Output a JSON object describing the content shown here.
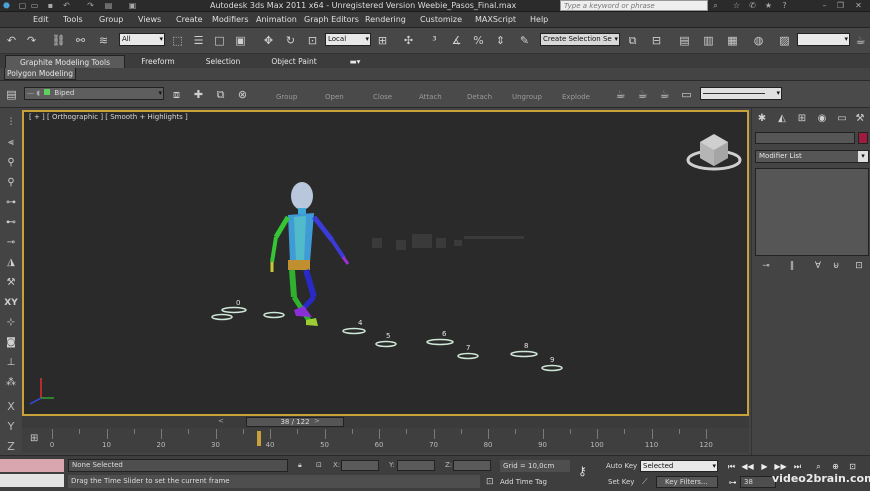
{
  "titlebar": {
    "title": "Autodesk 3ds Max  2011 x64   -  Unregistered Version   Weebie_Pasos_Final.max",
    "search_placeholder": "Type a keyword or phrase"
  },
  "menu": [
    "Edit",
    "Tools",
    "Group",
    "Views",
    "Create",
    "Modifiers",
    "Animation",
    "Graph Editors",
    "Rendering",
    "Customize",
    "MAXScript",
    "Help"
  ],
  "toolbar": {
    "selection_filter": "All",
    "ref_coord": "Local",
    "named_selection": "Create Selection Se"
  },
  "ribbon": {
    "tabs": [
      "Graphite Modeling Tools",
      "Freeform",
      "Selection",
      "Object Paint"
    ],
    "active_tab": "Graphite Modeling Tools",
    "panel_tab": "Polygon Modeling",
    "layer_dropdown": "Biped",
    "buttons": [
      "Group",
      "Open",
      "Close",
      "Attach",
      "Detach",
      "Ungroup",
      "Explode"
    ]
  },
  "viewport": {
    "label": "[ + ] [ Orthographic ] [ Smooth + Highlights ]",
    "footstep_labels": [
      "0",
      "4",
      "5",
      "6",
      "7",
      "8",
      "9"
    ]
  },
  "command_panel": {
    "modifier_list": "Modifier List",
    "color": "#9c1b3f"
  },
  "time_slider": {
    "label": "38 / 122",
    "prev": "<",
    "next": ">"
  },
  "track_ruler": {
    "labels": [
      "0",
      "10",
      "20",
      "30",
      "40",
      "50",
      "60",
      "70",
      "80",
      "90",
      "100",
      "110",
      "120"
    ],
    "current_frame": 38
  },
  "status": {
    "selection": "None Selected",
    "prompt": "Drag the Time Slider to set the current frame",
    "x_label": "X:",
    "y_label": "Y:",
    "z_label": "Z:",
    "grid": "Grid = 10,0cm",
    "add_time_tag": "Add Time Tag",
    "auto_key": "Auto Key",
    "set_key": "Set Key",
    "key_mode": "Selected",
    "key_filters": "Key Filters...",
    "frame": "38"
  },
  "watermark": "video2brain.com"
}
